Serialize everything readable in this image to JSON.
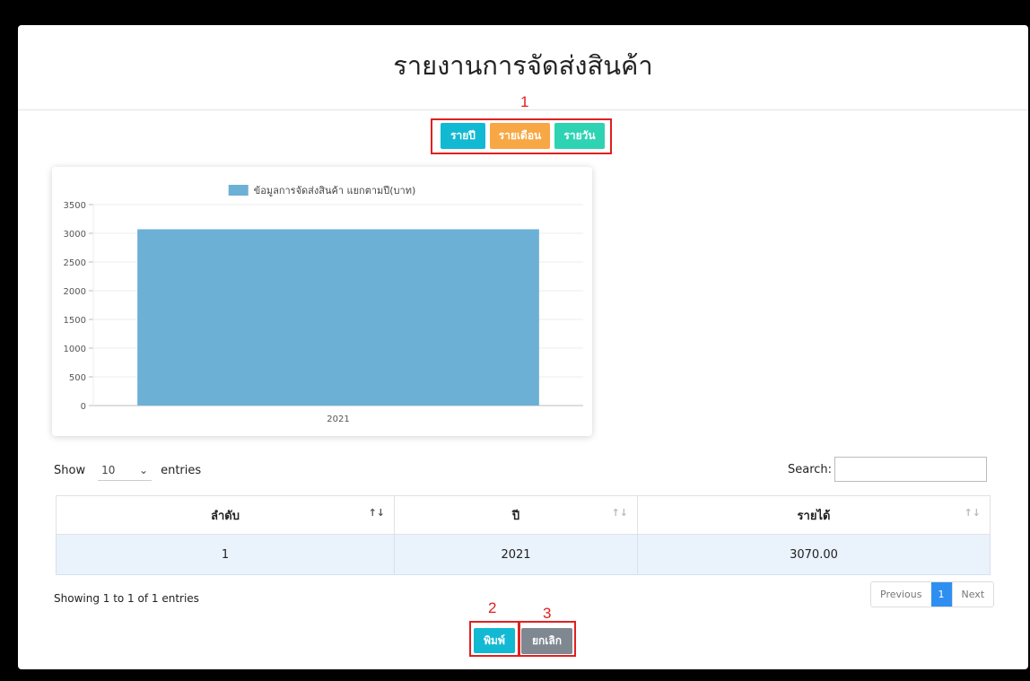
{
  "page": {
    "title": "รายงานการจัดส่งสินค้า"
  },
  "annotations": {
    "n1": "1",
    "n2": "2",
    "n3": "3",
    "color": "#e02020"
  },
  "period_buttons": {
    "yearly": {
      "label": "รายปี",
      "color": "#12b9d2"
    },
    "monthly": {
      "label": "รายเดือน",
      "color": "#f7a845"
    },
    "daily": {
      "label": "รายวัน",
      "color": "#2ed3b3"
    }
  },
  "chart_data": {
    "type": "bar",
    "legend": "ข้อมูลการจัดส่งสินค้า แยกตามปี(บาท)",
    "categories": [
      "2021"
    ],
    "values": [
      3070
    ],
    "ylim": [
      0,
      3500
    ],
    "yticks": [
      0,
      500,
      1000,
      1500,
      2000,
      2500,
      3000,
      3500
    ],
    "grid": true,
    "legend_position": "top",
    "bar_color": "#6cb0d6"
  },
  "table_controls": {
    "show_label": "Show",
    "page_size": "10",
    "entries_label": "entries",
    "search_label": "Search:",
    "search_value": ""
  },
  "table": {
    "headers": [
      "ลำดับ",
      "ปี",
      "รายได้"
    ],
    "rows": [
      [
        "1",
        "2021",
        "3070.00"
      ]
    ]
  },
  "pagination": {
    "info": "Showing 1 to 1 of 1 entries",
    "previous": "Previous",
    "current": "1",
    "next": "Next"
  },
  "actions": {
    "print": {
      "label": "พิมพ์",
      "color": "#12b9d2"
    },
    "cancel": {
      "label": "ยกเลิก",
      "color": "#7f8790"
    }
  }
}
